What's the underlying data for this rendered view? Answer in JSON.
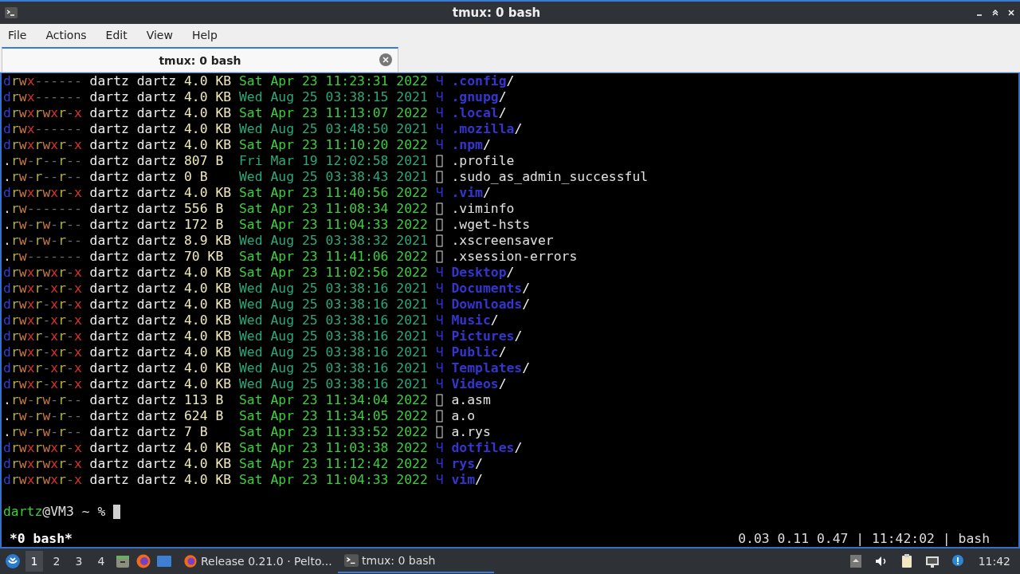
{
  "window": {
    "title": "tmux: 0 bash"
  },
  "menu": [
    "File",
    "Actions",
    "Edit",
    "View",
    "Help"
  ],
  "tabs": [
    {
      "label": "tmux: 0 bash",
      "selected": true
    }
  ],
  "listing": [
    {
      "perms": "drwx------",
      "owner": "dartz",
      "group": "dartz",
      "size": "4.0 KB",
      "date": "Sat Apr 23 11:23:31 2022",
      "recent": true,
      "kind": "dir",
      "icon": "Ч",
      "name": ".config",
      "suffix": "/"
    },
    {
      "perms": "drwx------",
      "owner": "dartz",
      "group": "dartz",
      "size": "4.0 KB",
      "date": "Wed Aug 25 03:38:15 2021",
      "recent": false,
      "kind": "dir",
      "icon": "Ч",
      "name": ".gnupg",
      "suffix": "/"
    },
    {
      "perms": "drwxrwxr-x",
      "owner": "dartz",
      "group": "dartz",
      "size": "4.0 KB",
      "date": "Sat Apr 23 11:13:07 2022",
      "recent": true,
      "kind": "dir",
      "icon": "Ч",
      "name": ".local",
      "suffix": "/"
    },
    {
      "perms": "drwx------",
      "owner": "dartz",
      "group": "dartz",
      "size": "4.0 KB",
      "date": "Wed Aug 25 03:48:50 2021",
      "recent": false,
      "kind": "dir",
      "icon": "Ч",
      "name": ".mozilla",
      "suffix": "/"
    },
    {
      "perms": "drwxrwxr-x",
      "owner": "dartz",
      "group": "dartz",
      "size": "4.0 KB",
      "date": "Sat Apr 23 11:10:20 2022",
      "recent": true,
      "kind": "dir",
      "icon": "Ч",
      "name": ".npm",
      "suffix": "/"
    },
    {
      "perms": ".rw-r--r--",
      "owner": "dartz",
      "group": "dartz",
      "size": "807 B",
      "date": "Fri Mar 19 12:02:58 2021",
      "recent": false,
      "kind": "file",
      "name": ".profile"
    },
    {
      "perms": ".rw-r--r--",
      "owner": "dartz",
      "group": "dartz",
      "size": "0 B",
      "date": "Wed Aug 25 03:38:43 2021",
      "recent": false,
      "kind": "file",
      "name": ".sudo_as_admin_successful"
    },
    {
      "perms": "drwxrwxr-x",
      "owner": "dartz",
      "group": "dartz",
      "size": "4.0 KB",
      "date": "Sat Apr 23 11:40:56 2022",
      "recent": true,
      "kind": "dir",
      "icon": "Ч",
      "name": ".vim",
      "suffix": "/"
    },
    {
      "perms": ".rw-------",
      "owner": "dartz",
      "group": "dartz",
      "size": "556 B",
      "date": "Sat Apr 23 11:08:34 2022",
      "recent": true,
      "kind": "file",
      "name": ".viminfo"
    },
    {
      "perms": ".rw-rw-r--",
      "owner": "dartz",
      "group": "dartz",
      "size": "172 B",
      "date": "Sat Apr 23 11:04:33 2022",
      "recent": true,
      "kind": "file",
      "name": ".wget-hsts"
    },
    {
      "perms": ".rw-rw-r--",
      "owner": "dartz",
      "group": "dartz",
      "size": "8.9 KB",
      "date": "Wed Aug 25 03:38:32 2021",
      "recent": false,
      "kind": "file",
      "name": ".xscreensaver"
    },
    {
      "perms": ".rw-------",
      "owner": "dartz",
      "group": "dartz",
      "size": "70 KB",
      "date": "Sat Apr 23 11:41:06 2022",
      "recent": true,
      "kind": "file",
      "name": ".xsession-errors"
    },
    {
      "perms": "drwxrwxr-x",
      "owner": "dartz",
      "group": "dartz",
      "size": "4.0 KB",
      "date": "Sat Apr 23 11:02:56 2022",
      "recent": true,
      "kind": "dir",
      "icon": "Ч",
      "name": "Desktop",
      "suffix": "/"
    },
    {
      "perms": "drwxr-xr-x",
      "owner": "dartz",
      "group": "dartz",
      "size": "4.0 KB",
      "date": "Wed Aug 25 03:38:16 2021",
      "recent": false,
      "kind": "dir",
      "icon": "Ч",
      "name": "Documents",
      "suffix": "/"
    },
    {
      "perms": "drwxr-xr-x",
      "owner": "dartz",
      "group": "dartz",
      "size": "4.0 KB",
      "date": "Wed Aug 25 03:38:16 2021",
      "recent": false,
      "kind": "dir",
      "icon": "Ч",
      "name": "Downloads",
      "suffix": "/"
    },
    {
      "perms": "drwxr-xr-x",
      "owner": "dartz",
      "group": "dartz",
      "size": "4.0 KB",
      "date": "Wed Aug 25 03:38:16 2021",
      "recent": false,
      "kind": "dir",
      "icon": "Ч",
      "name": "Music",
      "suffix": "/"
    },
    {
      "perms": "drwxr-xr-x",
      "owner": "dartz",
      "group": "dartz",
      "size": "4.0 KB",
      "date": "Wed Aug 25 03:38:16 2021",
      "recent": false,
      "kind": "dir",
      "icon": "Ч",
      "name": "Pictures",
      "suffix": "/"
    },
    {
      "perms": "drwxr-xr-x",
      "owner": "dartz",
      "group": "dartz",
      "size": "4.0 KB",
      "date": "Wed Aug 25 03:38:16 2021",
      "recent": false,
      "kind": "dir",
      "icon": "Ч",
      "name": "Public",
      "suffix": "/"
    },
    {
      "perms": "drwxr-xr-x",
      "owner": "dartz",
      "group": "dartz",
      "size": "4.0 KB",
      "date": "Wed Aug 25 03:38:16 2021",
      "recent": false,
      "kind": "dir",
      "icon": "Ч",
      "name": "Templates",
      "suffix": "/"
    },
    {
      "perms": "drwxr-xr-x",
      "owner": "dartz",
      "group": "dartz",
      "size": "4.0 KB",
      "date": "Wed Aug 25 03:38:16 2021",
      "recent": false,
      "kind": "dir",
      "icon": "Ч",
      "name": "Videos",
      "suffix": "/"
    },
    {
      "perms": ".rw-rw-r--",
      "owner": "dartz",
      "group": "dartz",
      "size": "113 B",
      "date": "Sat Apr 23 11:34:04 2022",
      "recent": true,
      "kind": "file",
      "name": "a.asm"
    },
    {
      "perms": ".rw-rw-r--",
      "owner": "dartz",
      "group": "dartz",
      "size": "624 B",
      "date": "Sat Apr 23 11:34:05 2022",
      "recent": true,
      "kind": "file",
      "name": "a.o"
    },
    {
      "perms": ".rw-rw-r--",
      "owner": "dartz",
      "group": "dartz",
      "size": "7 B",
      "date": "Sat Apr 23 11:33:52 2022",
      "recent": true,
      "kind": "file",
      "name": "a.rys"
    },
    {
      "perms": "drwxrwxr-x",
      "owner": "dartz",
      "group": "dartz",
      "size": "4.0 KB",
      "date": "Sat Apr 23 11:03:38 2022",
      "recent": true,
      "kind": "dir",
      "icon": "Ч",
      "name": "dotfiles",
      "suffix": "/"
    },
    {
      "perms": "drwxrwxr-x",
      "owner": "dartz",
      "group": "dartz",
      "size": "4.0 KB",
      "date": "Sat Apr 23 11:12:42 2022",
      "recent": true,
      "kind": "dir",
      "icon": "Ч",
      "name": "rys",
      "suffix": "/"
    },
    {
      "perms": "drwxrwxr-x",
      "owner": "dartz",
      "group": "dartz",
      "size": "4.0 KB",
      "date": "Sat Apr 23 11:04:33 2022",
      "recent": true,
      "kind": "dir",
      "icon": "Ч",
      "name": "vim",
      "suffix": "/"
    }
  ],
  "prompt": {
    "user": "dartz",
    "rest": "@VM3 ~ %"
  },
  "tmux_status": {
    "window": "*0 bash*",
    "info": "0.03 0.11 0.47 | 11:42:02 | bash"
  },
  "taskbar": {
    "workspaces": [
      {
        "label": "1",
        "selected": true
      },
      {
        "label": "2",
        "selected": false
      },
      {
        "label": "3",
        "selected": false
      },
      {
        "label": "4",
        "selected": false
      }
    ],
    "tasks": [
      {
        "label": "Release 0.21.0 · Pelto...",
        "kind": "browser",
        "selected": false
      },
      {
        "label": "tmux: 0 bash",
        "kind": "terminal",
        "selected": true
      }
    ],
    "clock": "11:42"
  }
}
